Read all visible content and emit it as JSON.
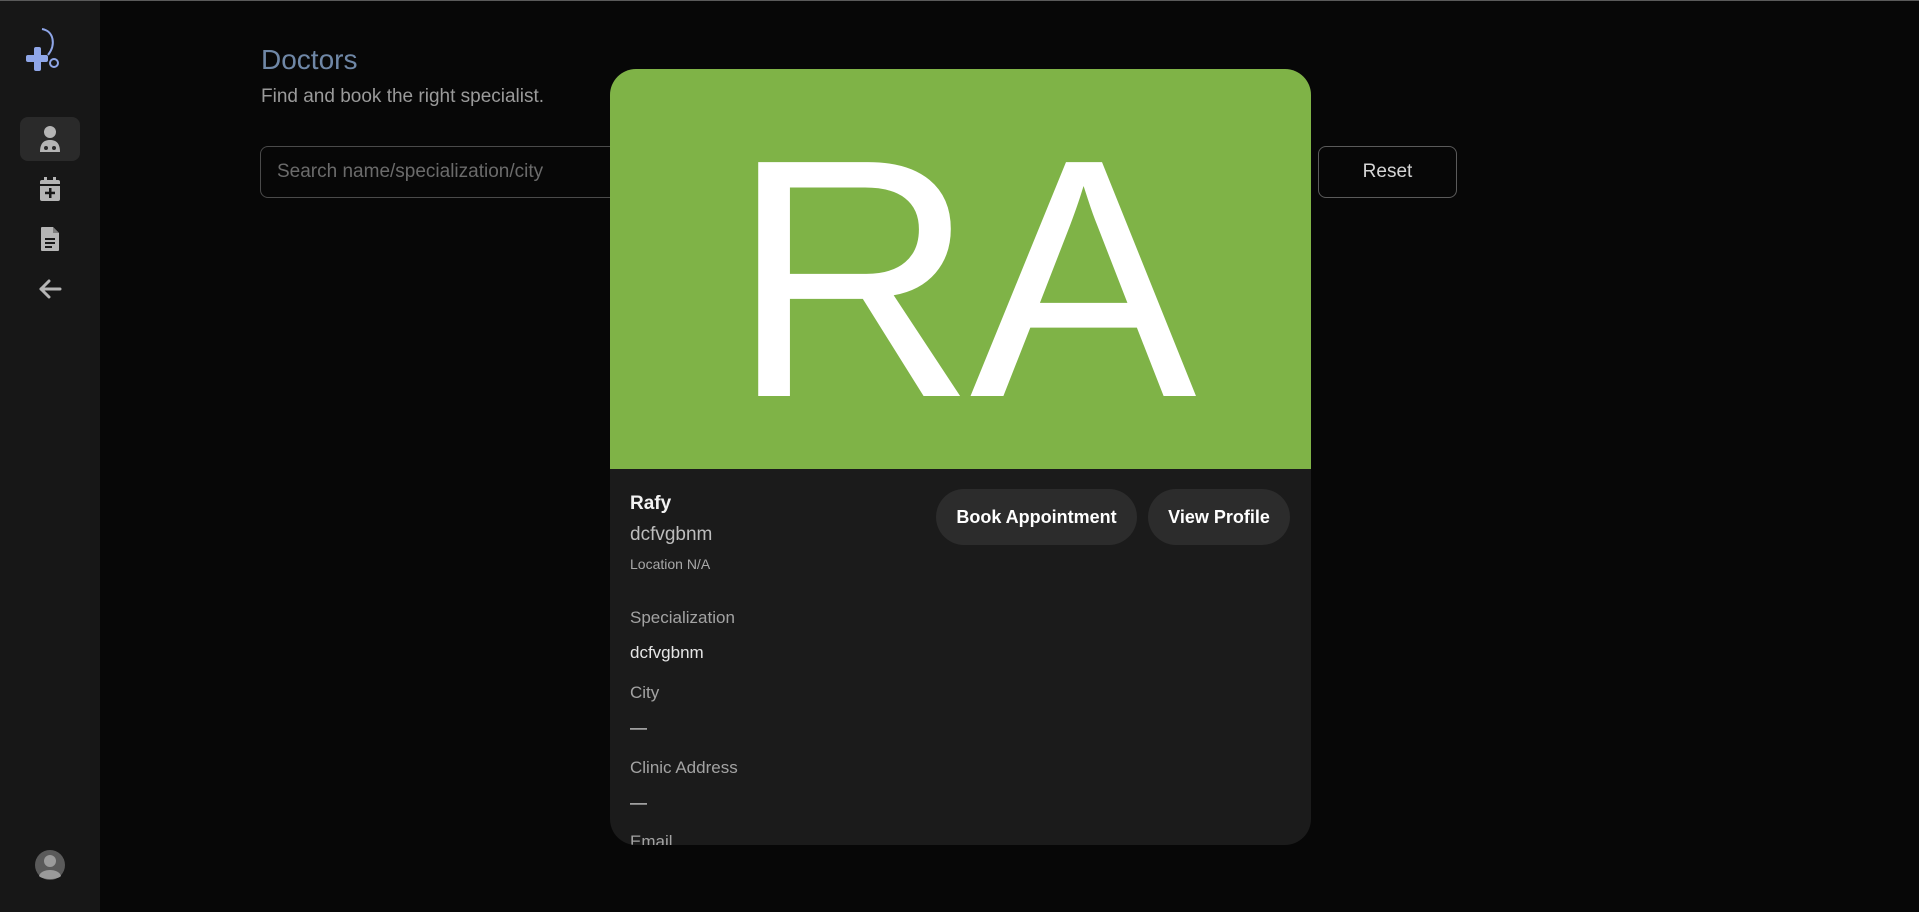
{
  "page": {
    "title": "Doctors",
    "subtitle": "Find and book the right specialist."
  },
  "search": {
    "placeholder": "Search name/specialization/city",
    "value": ""
  },
  "reset_label": "Reset",
  "sidebar": {
    "items": [
      {
        "icon": "doctor-icon",
        "active": true
      },
      {
        "icon": "calendar-add-icon",
        "active": false
      },
      {
        "icon": "document-icon",
        "active": false
      },
      {
        "icon": "arrow-left-icon",
        "active": false
      }
    ]
  },
  "doctor": {
    "initials": "RA",
    "name": "Rafy",
    "specialization_subtitle": "dcfvgbnm",
    "location": "Location N/A",
    "banner_color": "#7fb347",
    "book_label": "Book Appointment",
    "view_label": "View Profile",
    "fields": [
      {
        "label": "Specialization",
        "value": "dcfvgbnm"
      },
      {
        "label": "City",
        "value": "—"
      },
      {
        "label": "Clinic Address",
        "value": "—"
      },
      {
        "label": "Email",
        "value": ""
      }
    ]
  },
  "colors": {
    "background": "#070707",
    "sidebar": "#171717",
    "accent_title": "#6f87a6",
    "card": "#1b1b1b"
  }
}
